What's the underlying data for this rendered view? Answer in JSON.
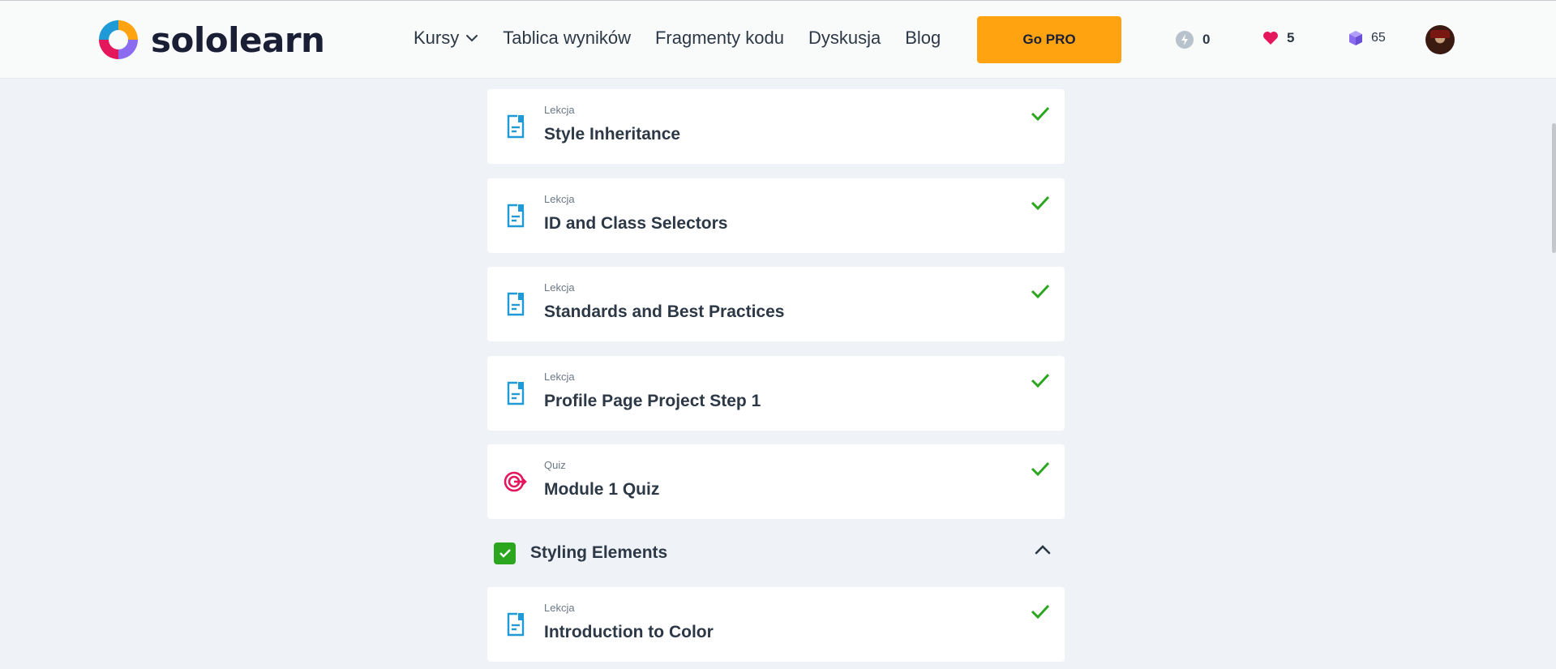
{
  "header": {
    "logo_text": "sololearn",
    "nav": [
      {
        "label": "Kursy",
        "has_dropdown": true
      },
      {
        "label": "Tablica wyników"
      },
      {
        "label": "Fragmenty kodu"
      },
      {
        "label": "Dyskusja"
      },
      {
        "label": "Blog"
      }
    ],
    "go_pro_label": "Go PRO",
    "stats": {
      "streak": "0",
      "hearts": "5",
      "bits": "65"
    }
  },
  "lessons": [
    {
      "kind": "Lekcja",
      "title": "Style Inheritance",
      "icon": "lesson-icon",
      "completed": true
    },
    {
      "kind": "Lekcja",
      "title": "ID and Class Selectors",
      "icon": "lesson-icon",
      "completed": true
    },
    {
      "kind": "Lekcja",
      "title": "Standards and Best Practices",
      "icon": "lesson-icon",
      "completed": true
    },
    {
      "kind": "Lekcja",
      "title": "Profile Page Project Step 1",
      "icon": "lesson-icon",
      "completed": true
    },
    {
      "kind": "Quiz",
      "title": "Module 1 Quiz",
      "icon": "quiz-target-icon",
      "completed": true
    }
  ],
  "section": {
    "title": "Styling Elements",
    "completed": true,
    "expanded": true
  },
  "section_lessons": [
    {
      "kind": "Lekcja",
      "title": "Introduction to Color",
      "icon": "lesson-icon",
      "completed": true
    }
  ],
  "colors": {
    "accent_orange": "#ffa310",
    "check_green": "#2ca61f",
    "lesson_blue": "#1e9bd7",
    "quiz_pink": "#e5175c",
    "heart_red": "#e5175c",
    "bits_purple": "#8b6cf0"
  }
}
